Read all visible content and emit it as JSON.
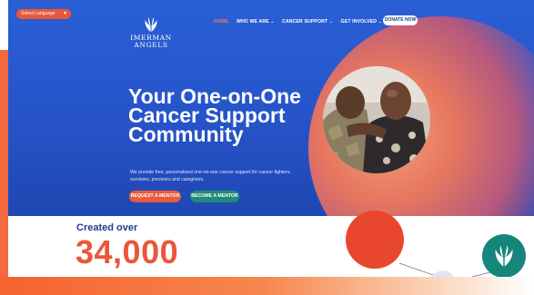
{
  "language_select": {
    "label": "Select Language",
    "icon": "chevron-down-icon"
  },
  "brand": {
    "name_line1": "IMERMAN",
    "name_line2": "ANGELS",
    "logo_icon": "angel-wings-icon"
  },
  "nav": {
    "items": [
      {
        "label": "HOME",
        "active": true,
        "has_dropdown": false
      },
      {
        "label": "WHO WE ARE",
        "active": false,
        "has_dropdown": true
      },
      {
        "label": "CANCER SUPPORT",
        "active": false,
        "has_dropdown": true
      },
      {
        "label": "GET INVOLVED",
        "active": false,
        "has_dropdown": true
      }
    ],
    "donate_label": "DONATE NOW"
  },
  "hero": {
    "headline": "Your One-on-One Cancer Support Community",
    "subtext": "We provide free, personalized one-on-one cancer support for cancer fighters, survivors, previvors and caregivers.",
    "request_label": "REQUEST A MENTOR",
    "become_label": "BECOME A MENTOR"
  },
  "stats": {
    "created_label": "Created over",
    "count": "34,000"
  },
  "colors": {
    "hero_blue": "#2a5fd6",
    "accent_orange": "#e9573a",
    "teal": "#1f8a78",
    "nav_active": "#f47a55"
  }
}
